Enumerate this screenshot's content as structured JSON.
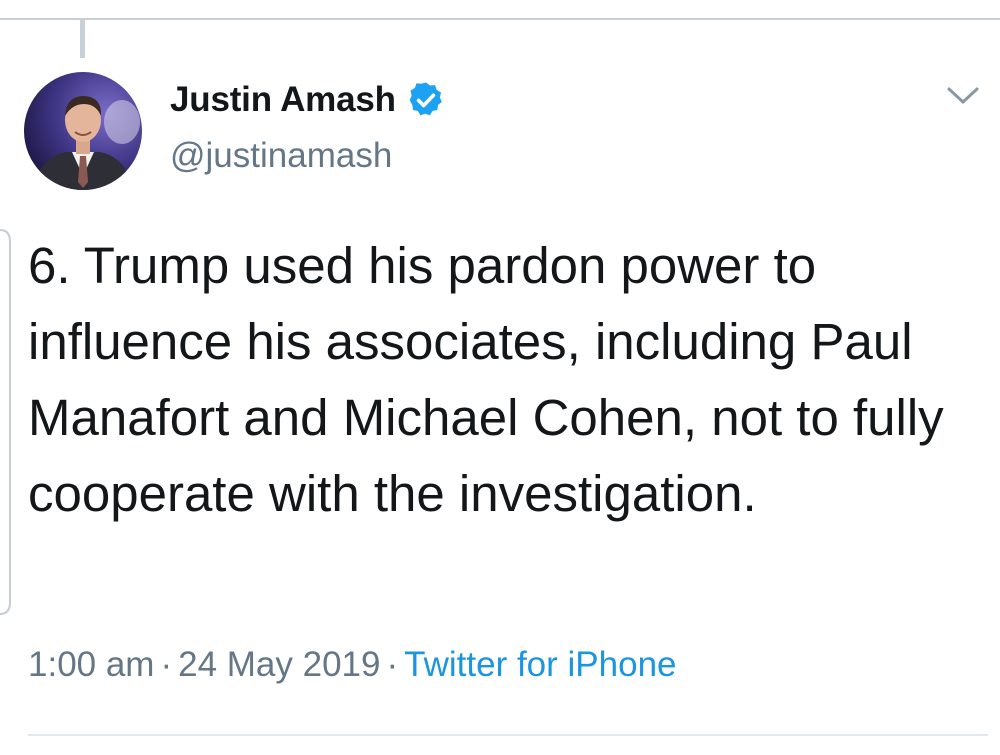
{
  "author": {
    "display_name": "Justin Amash",
    "handle": "@justinamash",
    "verified": true,
    "avatar_icon": "profile-photo"
  },
  "tweet": {
    "text": "6. Trump used his pardon power to influence his associates, including Paul Manafort and Michael Cohen, not to fully cooperate with the investigation."
  },
  "meta": {
    "time": "1:00 am",
    "separator": "·",
    "date": "24 May 2019",
    "source": "Twitter for iPhone"
  },
  "icons": {
    "verified": "verified-badge-icon",
    "menu": "chevron-down-icon"
  },
  "colors": {
    "text": "#14171a",
    "secondary": "#657786",
    "link": "#1b95e0",
    "verified": "#1da1f2"
  }
}
